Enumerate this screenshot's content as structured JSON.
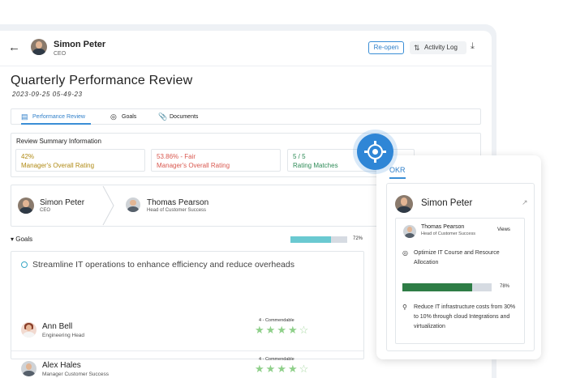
{
  "header": {
    "back_icon": "arrow-left-icon",
    "user_name": "Simon Peter",
    "user_role": "CEO",
    "reopen_label": "Re-open",
    "activity_label": "Activity Log",
    "download_icon": "download-icon"
  },
  "page": {
    "title": "Quarterly Performance Review",
    "date": "2023-09-25  05-49-23"
  },
  "tabs": [
    {
      "label": "Performance Review",
      "icon": "review-icon",
      "active": true
    },
    {
      "label": "Goals",
      "icon": "target-icon",
      "active": false
    },
    {
      "label": "Documents",
      "icon": "paperclip-icon",
      "active": false
    }
  ],
  "summary": {
    "title": "Review Summary Information",
    "cards": [
      {
        "value": "42%",
        "label": "Manager's Overall Rating",
        "color": "#b08a14"
      },
      {
        "value": "53.86% - Fair",
        "label": "Manager's Overall Rating",
        "color": "#d9584f"
      },
      {
        "value": "5 / 5",
        "label": "Rating Matches",
        "color": "#2e8b57"
      }
    ]
  },
  "people": {
    "reviewer": {
      "name": "Simon Peter",
      "role": "CEO"
    },
    "reviewee": {
      "name": "Thomas Pearson",
      "role": "Head of Customer Success"
    }
  },
  "goals": {
    "label": "Goals",
    "progress": 72,
    "progress_label": "72%",
    "objective": "Streamline IT operations to enhance efficiency and reduce overheads",
    "members": [
      {
        "name": "Ann Bell",
        "role": "Engineering Head",
        "rating_label": "4 - Commendable",
        "stars": 4,
        "max_stars": 5
      },
      {
        "name": "Alex Hales",
        "role": "Manager Customer Success",
        "rating_label": "4 - Commendable",
        "stars": 4,
        "max_stars": 5
      }
    ]
  },
  "okr": {
    "tab_label": "OKR",
    "name": "Simon Peter",
    "card": {
      "name": "Thomas Pearson",
      "role": "Head of Customer Success",
      "views_label": "Views",
      "item1": "Optimize IT Course and Resource Allocation",
      "progress": 78,
      "progress_label": "78%",
      "item2": "Reduce IT infrastructure costs from 30% to 10% through cloud Integrations and virtualization"
    }
  },
  "colors": {
    "accent": "#2f86d6",
    "goals_bar": "#6ac9d1",
    "okr_bar": "#2e7d46",
    "stars": "#8fd08a"
  }
}
